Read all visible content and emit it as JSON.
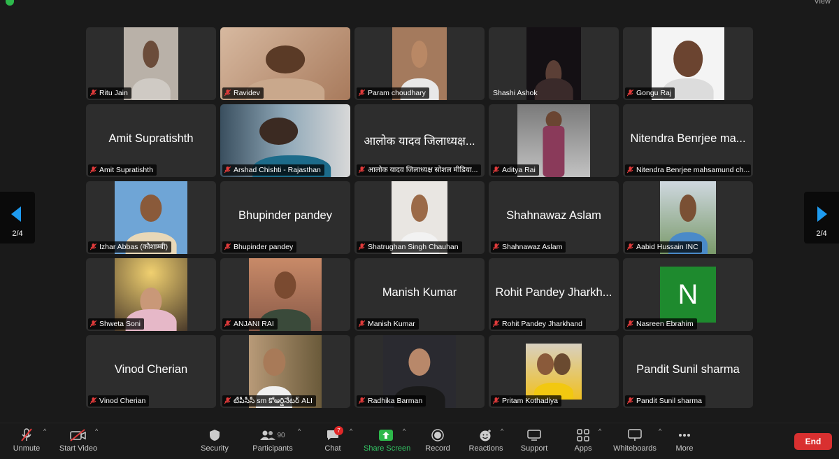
{
  "top": {
    "view_label": "View"
  },
  "pagination": {
    "left": "2/4",
    "right": "2/4"
  },
  "participants": [
    {
      "name": "Ritu Jain",
      "big": ""
    },
    {
      "name": "Ravidev",
      "big": ""
    },
    {
      "name": "Param choudhary",
      "big": ""
    },
    {
      "name": "Shashi Ashok",
      "big": ""
    },
    {
      "name": "Gongu Raj",
      "big": ""
    },
    {
      "name": "Amit Supratishth",
      "big": "Amit Supratishth"
    },
    {
      "name": "Arshad Chishti - Rajasthan",
      "big": ""
    },
    {
      "name": "आलोक यादव जिलाध्यक्ष सोशल मीडिया...",
      "big": "आलोक यादव जिलाध्यक्ष..."
    },
    {
      "name": "Aditya Rai",
      "big": ""
    },
    {
      "name": "Nitendra Benrjee mahsamund ch...",
      "big": "Nitendra Benrjee ma..."
    },
    {
      "name": "Izhar Abbas (कौशाम्बी)",
      "big": ""
    },
    {
      "name": "Bhupinder pandey",
      "big": "Bhupinder pandey"
    },
    {
      "name": "Shatrughan Singh Chauhan",
      "big": ""
    },
    {
      "name": "Shahnawaz Aslam",
      "big": "Shahnawaz Aslam"
    },
    {
      "name": "Aabid Hussain INC",
      "big": ""
    },
    {
      "name": "Shweta Soni",
      "big": ""
    },
    {
      "name": "ANJANI RAI",
      "big": ""
    },
    {
      "name": "Manish Kumar",
      "big": "Manish Kumar"
    },
    {
      "name": "Rohit Pandey Jharkhand",
      "big": "Rohit Pandey Jharkh..."
    },
    {
      "name": "Nasreen Ebrahim",
      "big": ""
    },
    {
      "name": "Vinod Cherian",
      "big": "Vinod Cherian"
    },
    {
      "name": "టీపీసీసీ sm కోఆర్డినేటర్ ALI",
      "big": ""
    },
    {
      "name": "Radhika Barman",
      "big": ""
    },
    {
      "name": "Pritam Kothadiya",
      "big": ""
    },
    {
      "name": "Pandit Sunil sharma",
      "big": "Pandit Sunil sharma"
    }
  ],
  "avatar_letter": "N",
  "toolbar": {
    "unmute": "Unmute",
    "start_video": "Start Video",
    "security": "Security",
    "participants": "Participants",
    "participants_count": "90",
    "chat": "Chat",
    "chat_badge": "7",
    "share_screen": "Share Screen",
    "record": "Record",
    "reactions": "Reactions",
    "support": "Support",
    "apps": "Apps",
    "whiteboards": "Whiteboards",
    "more": "More",
    "end": "End"
  },
  "colors": {
    "accent_blue": "#1e9bf0",
    "share_green": "#2db84b",
    "end_red": "#d93030",
    "avatar_green": "#1e8a2e"
  }
}
